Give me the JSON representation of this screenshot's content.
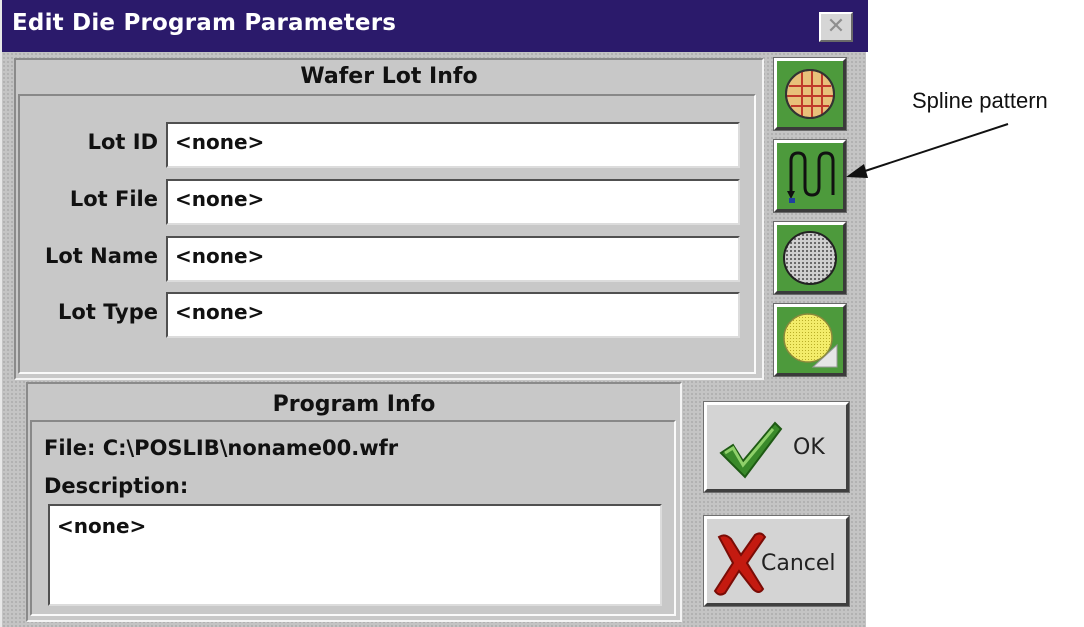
{
  "window": {
    "title": "Edit Die Program Parameters",
    "close_icon": "close-x-icon"
  },
  "wafer_lot_info": {
    "title": "Wafer Lot Info",
    "fields": [
      {
        "label": "Lot ID",
        "value": "<none>"
      },
      {
        "label": "Lot File",
        "value": "<none>"
      },
      {
        "label": "Lot Name",
        "value": "<none>"
      },
      {
        "label": "Lot Type",
        "value": "<none>"
      }
    ]
  },
  "program_info": {
    "title": "Program Info",
    "file_line": "File:  C:\\POSLIB\\noname00.wfr",
    "description_label": "Description:",
    "description_value": "<none>"
  },
  "pattern_buttons": [
    {
      "icon": "wafer-grid-icon"
    },
    {
      "icon": "spline-pattern-icon"
    },
    {
      "icon": "wafer-dots-icon"
    },
    {
      "icon": "wafer-yellow-icon"
    }
  ],
  "buttons": {
    "ok_label": "OK",
    "cancel_label": "Cancel"
  },
  "annotation": {
    "text": "Spline pattern"
  },
  "colors": {
    "title_bar": "#2b1a6b",
    "icon_button_bg": "#4d9a3c",
    "ok_check": "#3a8a2a",
    "cancel_x": "#c41a10"
  }
}
